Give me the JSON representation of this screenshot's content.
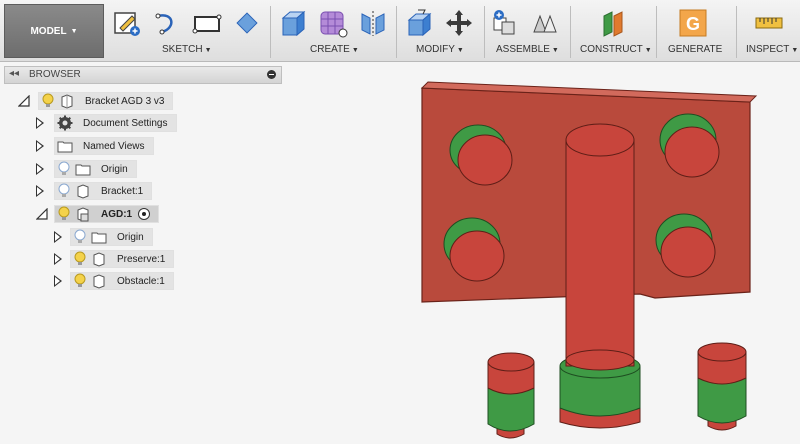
{
  "toolbar": {
    "workspace": "MODEL",
    "groups": [
      {
        "label": "SKETCH"
      },
      {
        "label": "CREATE"
      },
      {
        "label": "MODIFY"
      },
      {
        "label": "ASSEMBLE"
      },
      {
        "label": "CONSTRUCT"
      },
      {
        "label": "GENERATE"
      },
      {
        "label": "INSPECT"
      }
    ]
  },
  "browser": {
    "title": "BROWSER",
    "root": "Bracket AGD 3 v3",
    "items": [
      {
        "label": "Document Settings",
        "icon": "gear-icon"
      },
      {
        "label": "Named Views",
        "icon": "folder-icon"
      },
      {
        "label": "Origin",
        "icon": "folder-icon"
      },
      {
        "label": "Bracket:1",
        "icon": "body-icon"
      },
      {
        "label": "AGD:1",
        "icon": "component-icon"
      },
      {
        "label": "Origin",
        "icon": "folder-icon"
      },
      {
        "label": "Preserve:1",
        "icon": "body-icon"
      },
      {
        "label": "Obstacle:1",
        "icon": "body-icon"
      }
    ]
  },
  "colors": {
    "preserve_red": "#c8453c",
    "obstacle_green": "#3f9a45",
    "bracket_plate": "#b94a3c"
  }
}
